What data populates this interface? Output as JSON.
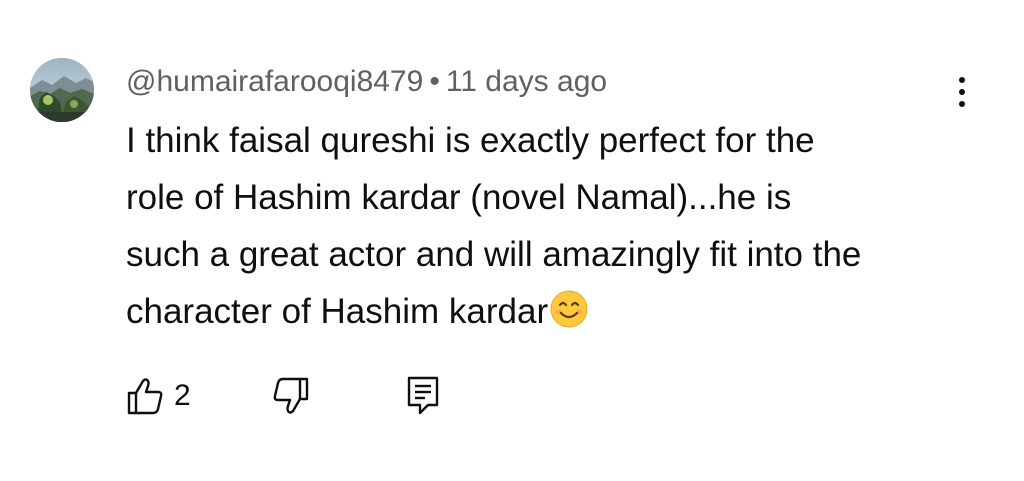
{
  "comment": {
    "author": "@humairafarooqi8479",
    "separator": "•",
    "time_ago": "11 days ago",
    "text_lines": [
      "I think faisal qureshi is exactly perfect for the",
      "role of Hashim kardar (novel Namal)...he is",
      "such a great actor and will amazingly fit into the",
      "character of Hashim kardar"
    ],
    "emoji": "smiling-face-emoji",
    "like_count": "2"
  },
  "icons": {
    "like": "thumbs-up-icon",
    "dislike": "thumbs-down-icon",
    "reply": "comment-reply-icon",
    "more": "more-vertical-icon"
  },
  "colors": {
    "text_primary": "#0f0f0f",
    "text_secondary": "#606060",
    "background": "#ffffff",
    "emoji_face": "#ffc93c"
  }
}
